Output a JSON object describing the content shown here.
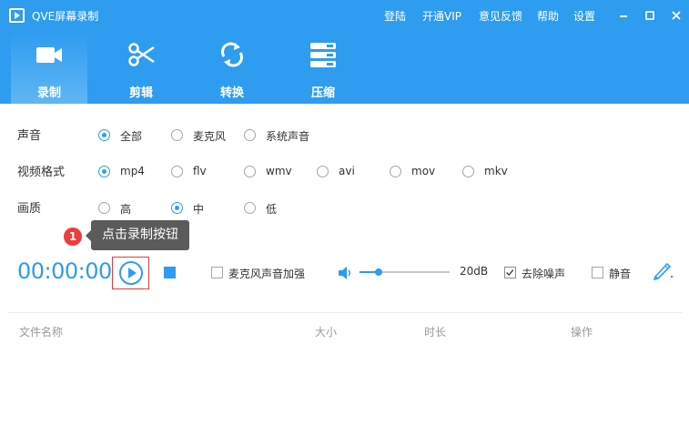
{
  "window": {
    "title": "QVE屏幕录制",
    "links": [
      "登陆",
      "开通VIP",
      "意见反馈",
      "帮助",
      "设置"
    ]
  },
  "tabs": [
    {
      "label": "录制",
      "icon": "video-camera-icon",
      "active": true
    },
    {
      "label": "剪辑",
      "icon": "scissors-icon",
      "active": false
    },
    {
      "label": "转换",
      "icon": "convert-arrows-icon",
      "active": false
    },
    {
      "label": "压缩",
      "icon": "compress-icon",
      "active": false
    }
  ],
  "settings": {
    "audio": {
      "label": "声音",
      "options": [
        "全部",
        "麦克风",
        "系统声音"
      ],
      "selected": "全部"
    },
    "format": {
      "label": "视频格式",
      "options": [
        "mp4",
        "flv",
        "wmv",
        "avi",
        "mov",
        "mkv"
      ],
      "selected": "mp4"
    },
    "quality": {
      "label": "画质",
      "options": [
        "高",
        "中",
        "低"
      ],
      "selected": "中"
    }
  },
  "tooltip": {
    "step": "1",
    "text": "点击录制按钮"
  },
  "controls": {
    "timer": "00:00:00",
    "mic_boost": {
      "label": "麦克风声音加强",
      "checked": false
    },
    "volume_percent": 21,
    "volume_db": "20dB",
    "denoise": {
      "label": "去除噪声",
      "checked": true
    },
    "mute": {
      "label": "静音",
      "checked": false
    }
  },
  "file_list": {
    "columns": [
      "文件名称",
      "大小",
      "时长",
      "操作"
    ]
  },
  "colors": {
    "accent": "#2e9cef",
    "tooltip_bg": "#5b5b5b",
    "badge": "#ee3b3b",
    "highlight": "#e23c3c"
  }
}
